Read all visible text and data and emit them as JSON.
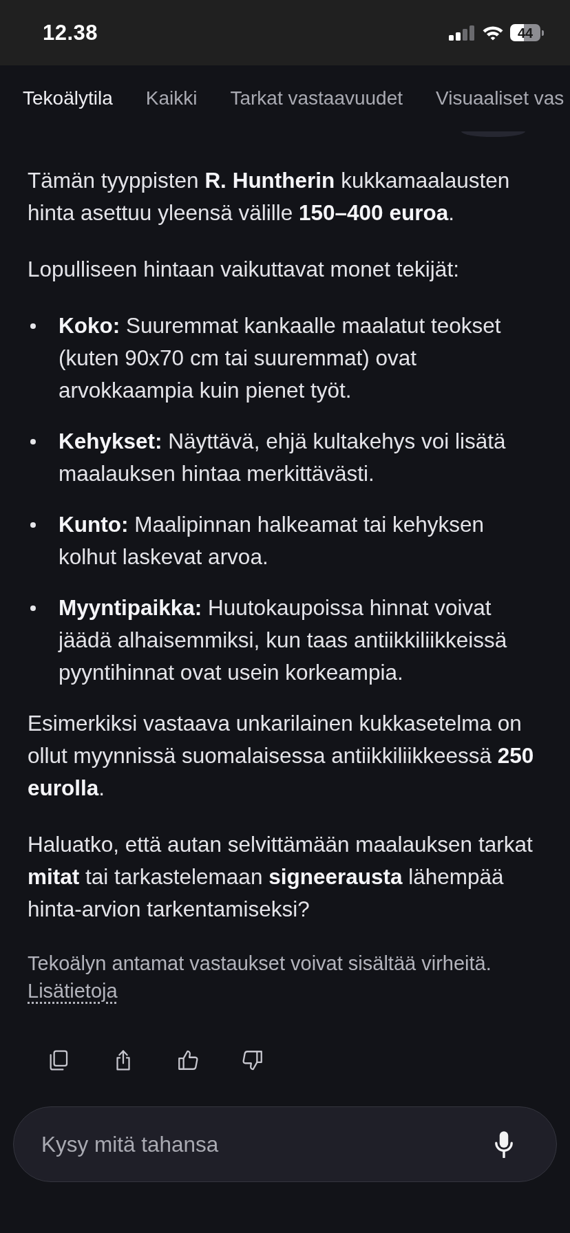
{
  "status_bar": {
    "time": "12.38",
    "battery": "44"
  },
  "tabs": [
    {
      "label": "Tekoälytila",
      "selected": true
    },
    {
      "label": "Kaikki",
      "selected": false
    },
    {
      "label": "Tarkat vastaavuudet",
      "selected": false
    },
    {
      "label": "Visuaaliset vas",
      "selected": false
    }
  ],
  "answer": [
    {
      "kind": "paragraph",
      "text": "Tämän tyyppisten **R. Huntherin** kukkamaalausten hinta asettuu yleensä välille **150–400 euroa**."
    },
    {
      "kind": "paragraph",
      "text": "Lopulliseen hintaan vaikuttavat monet tekijät:"
    },
    {
      "kind": "bullet",
      "text": "**Koko:** Suuremmat kankaalle maalatut teokset (kuten 90x70 cm tai suuremmat) ovat arvokkaampia kuin pienet työt."
    },
    {
      "kind": "bullet",
      "text": "**Kehykset:** Näyttävä, ehjä kultakehys voi lisätä maalauksen hintaa merkittävästi."
    },
    {
      "kind": "bullet",
      "text": "**Kunto:** Maalipinnan halkeamat tai kehyksen kolhut laskevat arvoa."
    },
    {
      "kind": "bullet",
      "text": "**Myyntipaikka:** Huutokaupoissa hinnat voivat jäädä alhaisemmiksi, kun taas antiikkiliikkeissä pyyntihinnat ovat usein korkeampia."
    },
    {
      "kind": "paragraph",
      "text": "Esimerkiksi vastaava unkarilainen kukkasetelma on ollut myynnissä suomalaisessa antiikkiliikkeessä **250 eurolla**."
    },
    {
      "kind": "paragraph",
      "text": "Haluatko, että autan selvittämään maalauksen tarkat **mitat** tai tarkastelemaan **signeerausta** lähempää hinta-arvion tarkentamiseksi?"
    }
  ],
  "disclaimer": {
    "text": "Tekoälyn antamat vastaukset voivat sisältää virheitä.",
    "link": "Lisätietoja"
  },
  "input": {
    "placeholder": "Kysy mitä tahansa"
  }
}
